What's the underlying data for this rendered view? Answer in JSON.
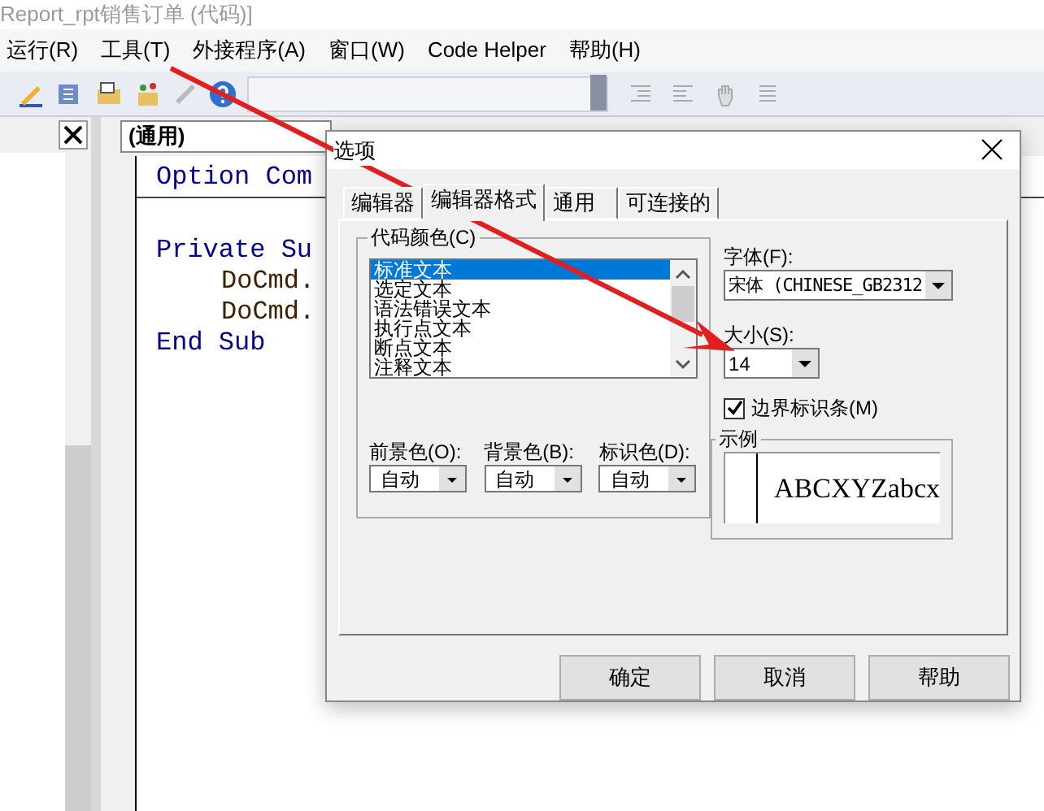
{
  "window": {
    "title": "Report_rpt销售订单 (代码)]"
  },
  "menu": [
    {
      "label": "运行(R)"
    },
    {
      "label": "工具(T)"
    },
    {
      "label": "外接程序(A)"
    },
    {
      "label": "窗口(W)"
    },
    {
      "label": "Code Helper"
    },
    {
      "label": "帮助(H)"
    }
  ],
  "object_combo": {
    "value": "(通用)"
  },
  "code_lines": [
    {
      "text": "Option Com",
      "kind": "declaration"
    },
    {
      "text": "Private Su",
      "kind": "top"
    },
    {
      "text": "DoCmd.",
      "kind": "indented"
    },
    {
      "text": "DoCmd.",
      "kind": "indented"
    },
    {
      "text": "End Sub",
      "kind": "top"
    }
  ],
  "dialog": {
    "title": "选项",
    "tabs": [
      {
        "label": "编辑器",
        "selected": false
      },
      {
        "label": "编辑器格式",
        "selected": true
      },
      {
        "label": "通用",
        "selected": false
      },
      {
        "label": "可连接的",
        "selected": false
      }
    ],
    "code_colors": {
      "label": "代码颜色(C)",
      "items": [
        {
          "label": "标准文本",
          "selected": true
        },
        {
          "label": "选定文本",
          "selected": false
        },
        {
          "label": "语法错误文本",
          "selected": false
        },
        {
          "label": "执行点文本",
          "selected": false
        },
        {
          "label": "断点文本",
          "selected": false
        },
        {
          "label": "注释文本",
          "selected": false
        }
      ]
    },
    "color_pickers": [
      {
        "label": "前景色(O):",
        "value": "自动"
      },
      {
        "label": "背景色(B):",
        "value": "自动"
      },
      {
        "label": "标识色(D):",
        "value": "自动"
      }
    ],
    "font": {
      "label": "字体(F):",
      "value": "宋体 (CHINESE_GB2312"
    },
    "size": {
      "label": "大小(S):",
      "value": "14"
    },
    "margin_indicator": {
      "label": "边界标识条(M)",
      "checked": true
    },
    "sample": {
      "label": "示例",
      "text": "ABCXYZabcx"
    },
    "buttons": [
      "确定",
      "取消",
      "帮助"
    ]
  }
}
